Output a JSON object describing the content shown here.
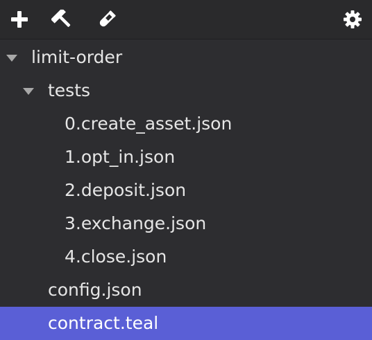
{
  "toolbar": {
    "icons": [
      "plus-icon",
      "hammer-icon",
      "test-tube-icon",
      "gear-icon"
    ]
  },
  "tree": {
    "root": {
      "label": "limit-order",
      "expanded": true
    },
    "tests_folder": {
      "label": "tests",
      "expanded": true
    },
    "test_files": [
      "0.create_asset.json",
      "1.opt_in.json",
      "2.deposit.json",
      "3.exchange.json",
      "4.close.json"
    ],
    "config_file": "config.json",
    "contract_file": "contract.teal",
    "selected": "contract.teal"
  },
  "colors": {
    "background": "#2d2d30",
    "selection": "#5a5fd6",
    "text": "#e6e6e6"
  }
}
